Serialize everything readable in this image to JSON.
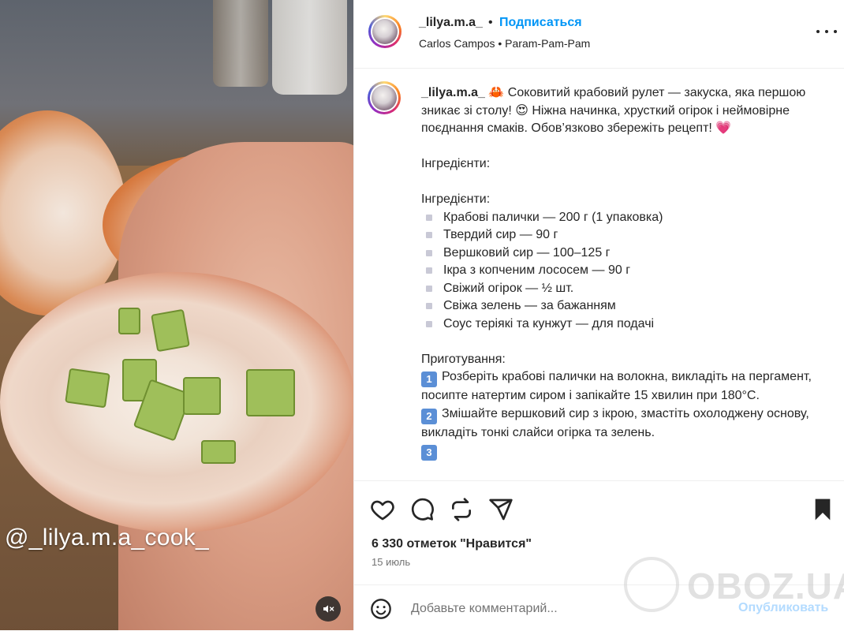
{
  "media": {
    "overlay_text": "@_lilya.m.a_cook_",
    "mute_icon": "speaker-muted-icon"
  },
  "header": {
    "username": "_lilya.m.a_",
    "separator": "•",
    "follow_label": "Подписаться",
    "audio_artist": "Carlos Campos",
    "audio_separator": "•",
    "audio_track": "Param-Pam-Pam",
    "more_icon": "more-options-icon"
  },
  "caption": {
    "username": "_lilya.m.a_",
    "crab_emoji": "🦀",
    "intro_1": " Соковитий крабовий рулет — закуска, яка першою зникає зі столу! ",
    "heart_eyes_emoji": "😍",
    "intro_2": " Ніжна начинка, хрусткий огірок і неймовірне поєднання смаків. Обов’язково збережіть рецепт! ",
    "heart_emoji": "💗",
    "ingredients_heading_1": "Інгредієнти:",
    "ingredients_heading_2": "Інгредієнти:",
    "ingredients": [
      "Крабові палички — 200 г (1 упаковка)",
      "Твердий сир — 90 г",
      "Вершковий сир — 100–125 г",
      "Ікра з копченим лососем — 90 г",
      "Свіжий огірок — ½ шт.",
      "Свіжа зелень — за бажанням",
      "Соус теріякі та кунжут — для подачі"
    ],
    "preparation_heading": "Приготування:",
    "steps": [
      {
        "key": "1",
        "text": "Розберіть крабові палички на волокна, викладіть на пергамент, посипте натертим сиром і запікайте 15 хвилин при 180°С."
      },
      {
        "key": "2",
        "text": "Змішайте вершковий сир з ікрою, змастіть охолоджену основу, викладіть тонкі слайси огірка та зелень."
      },
      {
        "key": "3",
        "text": ""
      }
    ]
  },
  "actions": {
    "like_icon": "heart-icon",
    "comment_icon": "comment-icon",
    "share_icon": "repost-icon",
    "send_icon": "send-icon",
    "save_icon": "bookmark-icon"
  },
  "likes_text": "6 330 отметок \"Нравится\"",
  "date_text": "15 июль",
  "comment": {
    "placeholder": "Добавьте комментарий...",
    "publish_label": "Опубликовать",
    "emoji_icon": "emoji-icon"
  },
  "watermark": {
    "text": "OBOZ.UA"
  }
}
